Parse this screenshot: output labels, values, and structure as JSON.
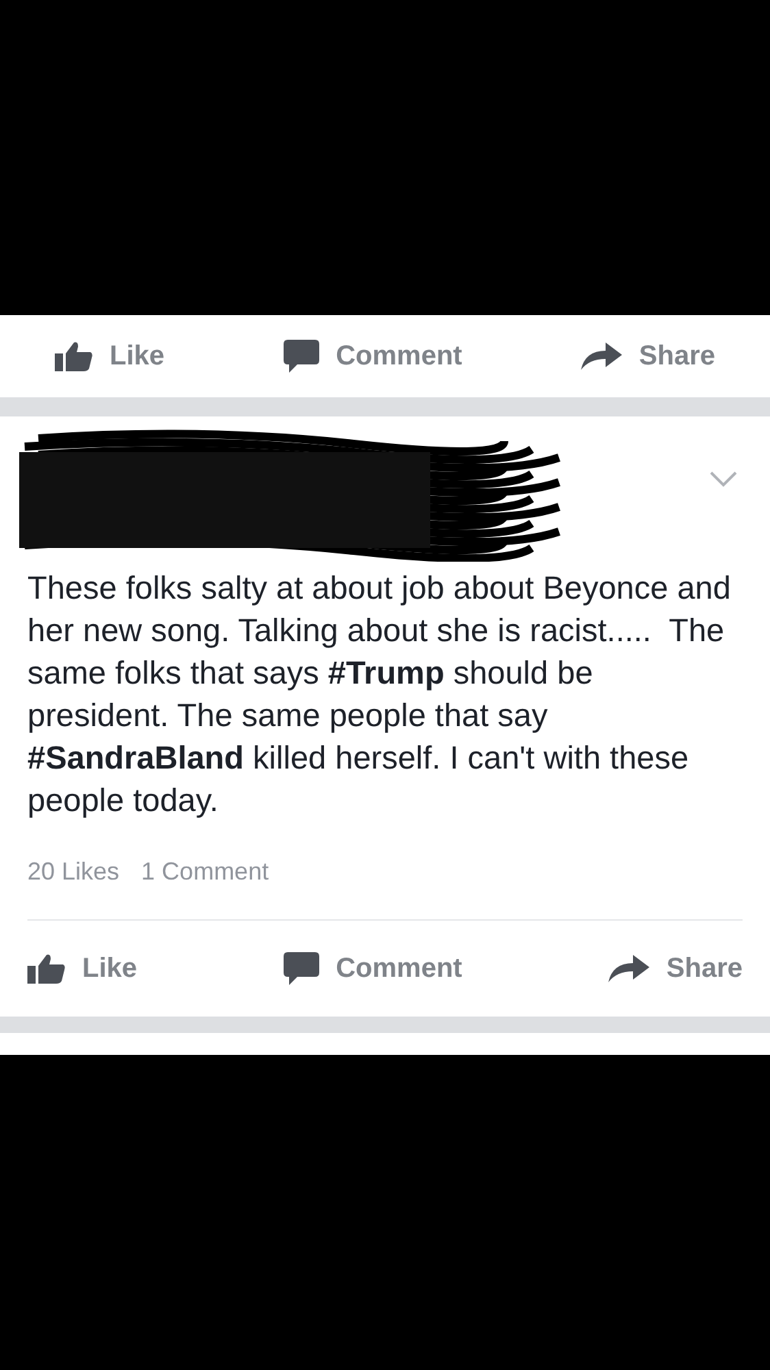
{
  "top_action_bar": {
    "buttons": [
      {
        "kind": "like",
        "label": "Like"
      },
      {
        "kind": "comment",
        "label": "Comment"
      },
      {
        "kind": "share",
        "label": "Share"
      }
    ]
  },
  "post": {
    "author_redacted": true,
    "text": "These folks salty at about job about Beyonce and her new song. Talking about she is racist.....  The same folks that says **#Trump** should be president. The same people that say **#SandraBland** killed herself. I can't with these people today.",
    "likes": "20 Likes",
    "comments": "1 Comment",
    "action_bar": {
      "buttons": [
        {
          "kind": "like",
          "label": "Like"
        },
        {
          "kind": "comment",
          "label": "Comment"
        },
        {
          "kind": "share",
          "label": "Share"
        }
      ]
    }
  }
}
